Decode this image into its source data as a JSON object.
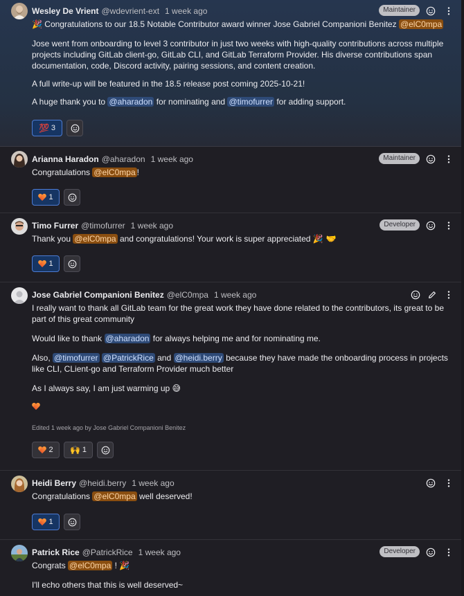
{
  "notes": [
    {
      "author": "Wesley De Vrient",
      "handle": "@wdevrient-ext",
      "time": "1 week ago",
      "role": "Maintainer",
      "line1_emoji": "🎉",
      "line1_text": "Congratulations to our 18.5 Notable Contributor award winner Jose Gabriel Companioni Benitez",
      "line1_mention": "@elC0mpa",
      "p2": "Jose went from onboarding to level 3 contributor in just two weeks with high-quality contributions across multiple projects including GitLab client-go, GitLab CLI, and GitLab Terraform Provider. His diverse contributions span documentation, code, Discord activity, pairing sessions, and content creation.",
      "p3": "A full write-up will be featured in the 18.5 release post coming 2025-10-21!",
      "p4_a": "A huge thank you to",
      "p4_m1": "@aharadon",
      "p4_b": "for nominating and",
      "p4_m2": "@timofurrer",
      "p4_c": "for adding support.",
      "reaction_emoji": "💯",
      "reaction_count": "3"
    },
    {
      "author": "Arianna Haradon",
      "handle": "@aharadon",
      "time": "1 week ago",
      "role": "Maintainer",
      "text_a": "Congratulations",
      "mention": "@elC0mpa",
      "text_b": "!",
      "reaction_count": "1"
    },
    {
      "author": "Timo Furrer",
      "handle": "@timofurrer",
      "time": "1 week ago",
      "role": "Developer",
      "text_a": "Thank you",
      "mention": "@elC0mpa",
      "text_b": "and congratulations! Your work is super appreciated",
      "emojis": "🎉 🤝",
      "reaction_count": "1"
    },
    {
      "author": "Jose Gabriel Companioni Benitez",
      "handle": "@elC0mpa",
      "time": "1 week ago",
      "p1": "I really want to thank all GitLab team for the great work they have done related to the contributors, its great to be part of this great community",
      "p2_a": "Would like to thank",
      "p2_m": "@aharadon",
      "p2_b": "for always helping me and for nominating me.",
      "p3_a": "Also,",
      "p3_m1": "@timofurrer",
      "p3_m2": "@PatrickRice",
      "p3_and": "and",
      "p3_m3": "@heidi.berry",
      "p3_b": "because they have made the onboarding process in projects like CLI, CLient-go and Terraform Provider much better",
      "p4": "As I always say, I am just warming up",
      "p4_emoji": "😅",
      "edited": "Edited 1 week ago by Jose Gabriel Companioni Benitez",
      "reaction1_count": "2",
      "reaction2_emoji": "🙌",
      "reaction2_count": "1"
    },
    {
      "author": "Heidi Berry",
      "handle": "@heidi.berry",
      "time": "1 week ago",
      "text_a": "Congratulations",
      "mention": "@elC0mpa",
      "text_b": "well deserved!",
      "reaction_count": "1"
    },
    {
      "author": "Patrick Rice",
      "handle": "@PatrickRice",
      "time": "1 week ago",
      "role": "Developer",
      "text_a": "Congrats",
      "mention": "@elC0mpa",
      "text_b": "!",
      "emoji": "🎉",
      "p2": "I'll echo others that this is well deserved~"
    }
  ],
  "icons": {
    "emoji": "smile-icon",
    "more": "kebab-icon",
    "edit": "pencil-icon"
  },
  "colors": {
    "background": "#1f1e24",
    "highlight": "#243143",
    "mention": "#2e4a77",
    "self_mention": "#8a4e10",
    "active_reaction": "#163563"
  }
}
